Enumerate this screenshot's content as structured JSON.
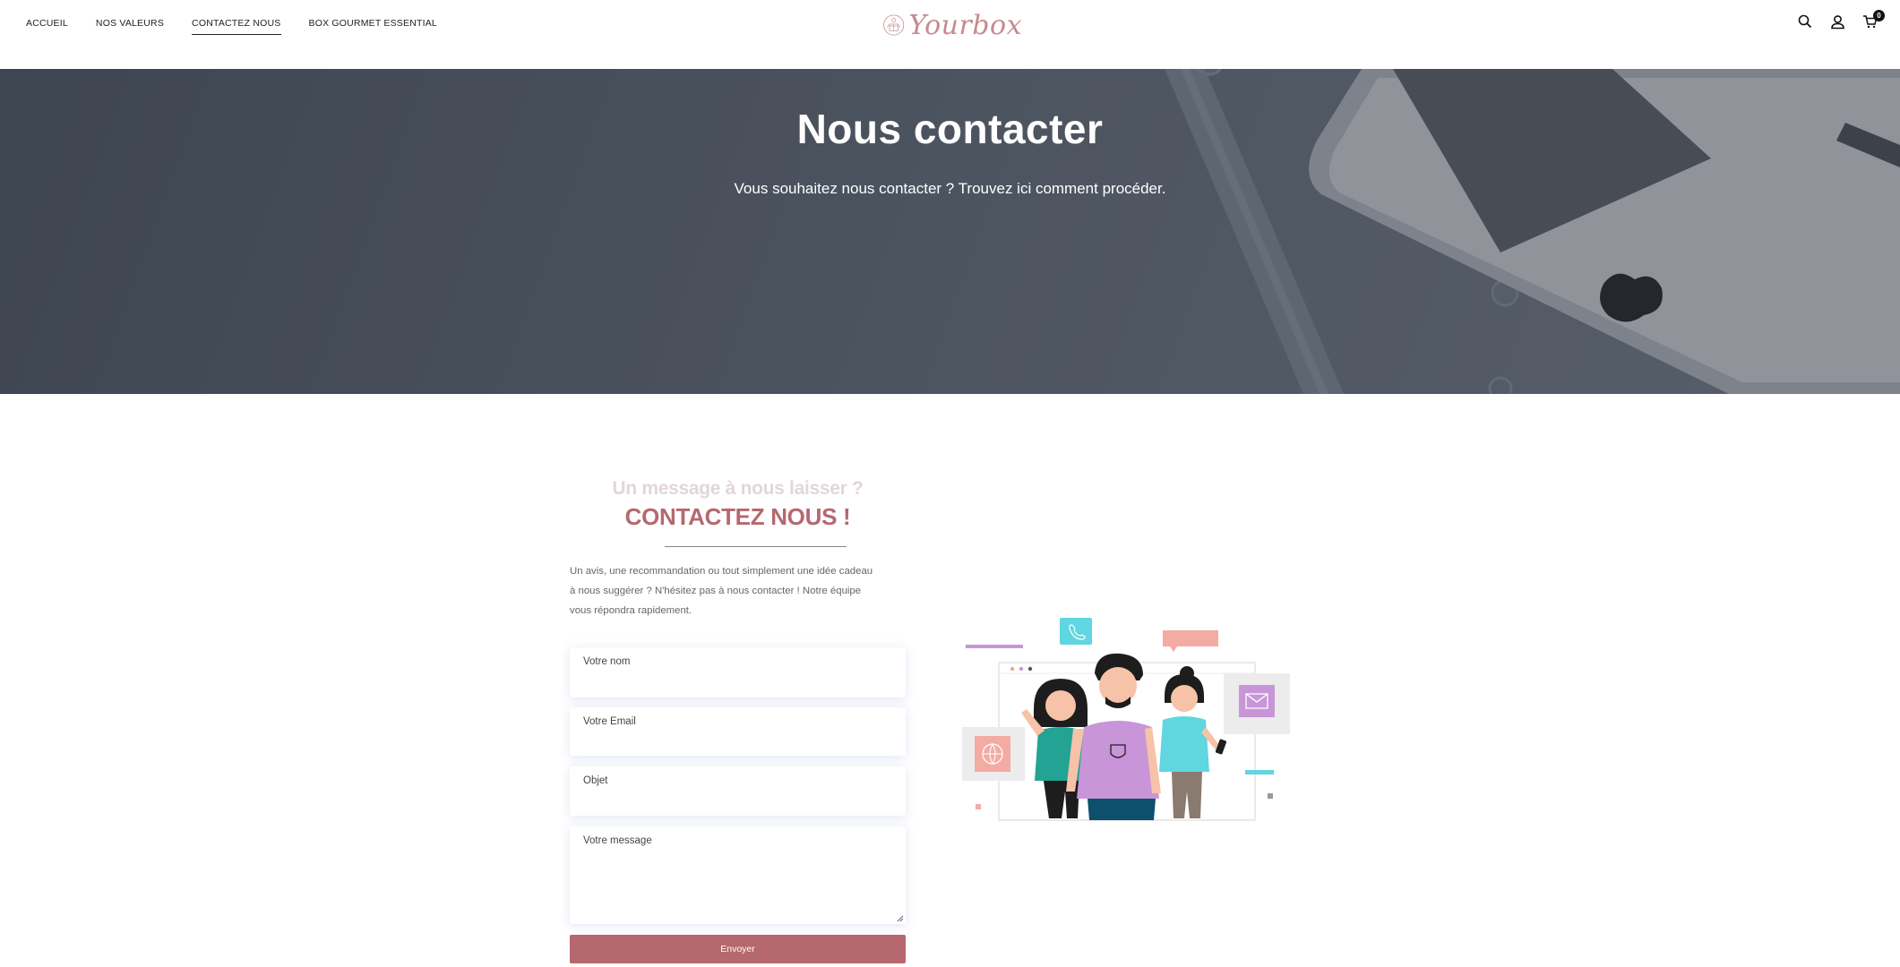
{
  "nav": {
    "items": [
      {
        "label": "ACCUEIL",
        "active": false
      },
      {
        "label": "NOS VALEURS",
        "active": false
      },
      {
        "label": "CONTACTEZ NOUS",
        "active": true
      },
      {
        "label": "BOX GOURMET ESSENTIAL",
        "active": false
      }
    ]
  },
  "brand": {
    "logo_text": "Yourbox",
    "logo_color": "#c68a8e"
  },
  "header_icons": {
    "search": "search-icon",
    "account": "user-icon",
    "cart": "cart-icon",
    "cart_count": "0"
  },
  "hero": {
    "title": "Nous contacter",
    "subtitle": "Vous souhaitez nous contacter ? Trouvez ici comment procéder."
  },
  "contact": {
    "pre_title": "Un message à nous laisser ?",
    "title": "CONTACTEZ NOUS !",
    "intro_lines": [
      "Un avis, une recommandation ou tout simplement une idée cadeau",
      "à nous suggérer ? N'hésitez pas à nous contacter ! Notre équipe",
      "vous répondra rapidement."
    ],
    "form": {
      "name_label": "Votre nom",
      "name_value": "",
      "email_label": "Votre Email",
      "email_value": "",
      "subject_label": "Objet",
      "subject_value": "",
      "message_label": "Votre message",
      "message_value": "",
      "submit_label": "Envoyer"
    }
  },
  "colors": {
    "accent": "#b5686e",
    "accent_light": "#e2d6d7"
  }
}
